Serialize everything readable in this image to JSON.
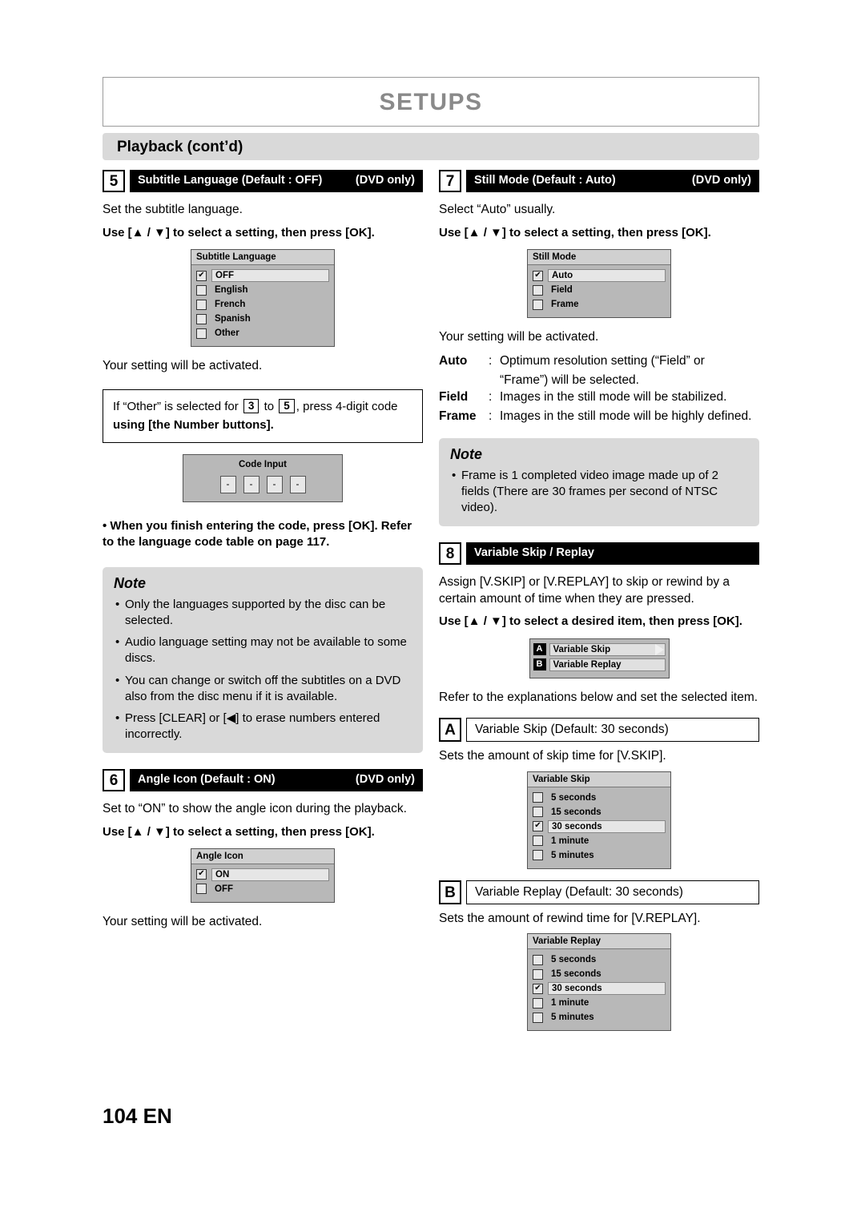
{
  "header": {
    "title": "SETUPS",
    "section": "Playback (cont’d)"
  },
  "left": {
    "item5": {
      "num": "5",
      "title": "Subtitle Language (Default : OFF)",
      "tag": "(DVD only)",
      "intro": "Set the subtitle language.",
      "instruction": "Use [▲ / ▼] to select a setting, then press [OK].",
      "menu": {
        "title": "Subtitle Language",
        "rows": [
          {
            "label": "OFF",
            "checked": true
          },
          {
            "label": "English",
            "checked": false
          },
          {
            "label": "French",
            "checked": false
          },
          {
            "label": "Spanish",
            "checked": false
          },
          {
            "label": "Other",
            "checked": false
          }
        ]
      },
      "activated": "Your setting will be activated.",
      "boxed_1": "If “Other” is selected for",
      "boxed_key1": "3",
      "boxed_2": "to",
      "boxed_key2": "5",
      "boxed_3": ", press 4-digit code",
      "boxed_4": "using [the Number buttons].",
      "code": {
        "title": "Code Input",
        "cells": [
          "-",
          "-",
          "-",
          "-"
        ]
      },
      "bullet_after": "• When you finish entering the code, press [OK]. Refer to the language code table on page 117.",
      "note": {
        "title": "Note",
        "items": [
          "Only the languages supported by the disc can be selected.",
          "Audio language setting may not be available to some discs.",
          "You can change or switch off the subtitles on a DVD also from the disc menu if it is available.",
          "Press [CLEAR] or [◀] to erase numbers entered incorrectly."
        ]
      }
    },
    "item6": {
      "num": "6",
      "title": "Angle Icon (Default : ON)",
      "tag": "(DVD only)",
      "intro": "Set to “ON” to show the angle icon during the playback.",
      "instruction": "Use [▲ / ▼] to select a setting, then press [OK].",
      "menu": {
        "title": "Angle Icon",
        "rows": [
          {
            "label": "ON",
            "checked": true
          },
          {
            "label": "OFF",
            "checked": false
          }
        ]
      },
      "activated": "Your setting will be activated."
    }
  },
  "right": {
    "item7": {
      "num": "7",
      "title": "Still Mode (Default : Auto)",
      "tag": "(DVD only)",
      "intro": "Select “Auto” usually.",
      "instruction": "Use [▲ / ▼] to select a setting, then press [OK].",
      "menu": {
        "title": "Still Mode",
        "rows": [
          {
            "label": "Auto",
            "checked": true
          },
          {
            "label": "Field",
            "checked": false
          },
          {
            "label": "Frame",
            "checked": false
          }
        ]
      },
      "activated": "Your setting will be activated.",
      "definitions": [
        {
          "key": "Auto",
          "value": "Optimum resolution setting (“Field” or",
          "cont": "“Frame”) will be selected."
        },
        {
          "key": "Field",
          "value": "Images in the still mode will be stabilized.",
          "cont": ""
        },
        {
          "key": "Frame",
          "value": "Images in the still mode will be highly defined.",
          "cont": ""
        }
      ],
      "note": {
        "title": "Note",
        "items": [
          "Frame is 1 completed video image made up of 2 fields (There are 30 frames per second of NTSC video)."
        ]
      }
    },
    "item8": {
      "num": "8",
      "title": "Variable Skip / Replay",
      "tag": "",
      "intro": "Assign [V.SKIP] or [V.REPLAY] to skip or rewind by a certain amount of time when they are pressed.",
      "instruction": "Use [▲ / ▼] to select a desired item, then press [OK].",
      "ab_menu": {
        "rows": [
          {
            "tag": "A",
            "label": "Variable Skip"
          },
          {
            "tag": "B",
            "label": "Variable Replay"
          }
        ]
      },
      "refer": "Refer to the explanations below and set the selected item.",
      "a_label": "Variable Skip (Default: 30 seconds)",
      "a_tag": "A",
      "a_desc": "Sets the amount of skip time for [V.SKIP].",
      "a_menu": {
        "title": "Variable Skip",
        "rows": [
          {
            "label": "5 seconds",
            "checked": false
          },
          {
            "label": "15 seconds",
            "checked": false
          },
          {
            "label": "30 seconds",
            "checked": true
          },
          {
            "label": "1 minute",
            "checked": false
          },
          {
            "label": "5 minutes",
            "checked": false
          }
        ]
      },
      "b_label": "Variable Replay (Default: 30 seconds)",
      "b_tag": "B",
      "b_desc": "Sets the amount of rewind time for [V.REPLAY].",
      "b_menu": {
        "title": "Variable Replay",
        "rows": [
          {
            "label": "5 seconds",
            "checked": false
          },
          {
            "label": "15 seconds",
            "checked": false
          },
          {
            "label": "30 seconds",
            "checked": true
          },
          {
            "label": "1 minute",
            "checked": false
          },
          {
            "label": "5 minutes",
            "checked": false
          }
        ]
      }
    }
  },
  "footer": {
    "page": "104 EN"
  }
}
